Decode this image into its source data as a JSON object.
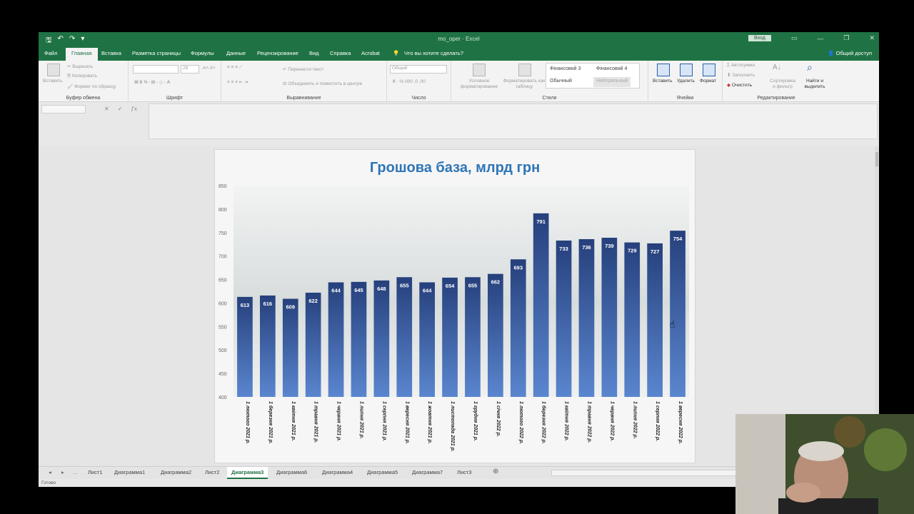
{
  "window": {
    "title": "mo_oper · Excel",
    "signin": "Вход",
    "share": "Общий доступ"
  },
  "tabs": [
    "Файл",
    "Главная",
    "Вставка",
    "Разметка страницы",
    "Формулы",
    "Данные",
    "Рецензирование",
    "Вид",
    "Справка",
    "Acrobat"
  ],
  "tell_me": "Что вы хотите сделать?",
  "ribbon": {
    "clipboard": {
      "paste": "Вставить",
      "cut": "Вырезать",
      "copy": "Копировать",
      "format_painter": "Формат по образцу",
      "label": "Буфер обмена"
    },
    "font": {
      "size": "28",
      "label": "Шрифт"
    },
    "alignment": {
      "wrap": "Перенести текст",
      "merge": "Объединить и поместить в центре",
      "label": "Выравнивание"
    },
    "number": {
      "format": "Общий",
      "label": "Число"
    },
    "styles": {
      "conditional": "Условное форматирование",
      "as_table": "Форматировать как таблицу",
      "cell_styles": [
        "Фінансовий 3",
        "Фінансовий 4",
        "Обычный",
        "Нейтральный"
      ],
      "label": "Стили"
    },
    "cells": {
      "insert": "Вставить",
      "delete": "Удалить",
      "format": "Формат",
      "label": "Ячейки"
    },
    "editing": {
      "autosum": "Автосумма",
      "fill": "Заполнить",
      "clear": "Очистить",
      "sort": "Сортировка и фильтр",
      "find": "Найти и выделить",
      "label": "Редактирование"
    }
  },
  "sheets": [
    "Лист1",
    "Диаграмма1",
    "Диаграмма2",
    "Лист2",
    "Диаграмма3",
    "Диаграмма6",
    "Диаграмма4",
    "Диаграмма5",
    "Диаграмма7",
    "Лист3"
  ],
  "active_sheet": "Диаграмма3",
  "status": "Готово",
  "colors": {
    "excel_green": "#1f7244",
    "bar_top": "#26407c",
    "bar_bottom": "#5a86cf",
    "title": "#2e75b6"
  },
  "chart_data": {
    "type": "bar",
    "title": "Грошова база, млрд грн",
    "categories": [
      "1 лютого 2021 р.",
      "1 березня 2021 р.",
      "1 квітня 2021 р.",
      "1 травня 2021 р.",
      "1 червня 2021 р.",
      "1 липня 2021 р.",
      "1 серпня 2021 р.",
      "1 вересня 2021 р.",
      "1 жовтня 2021 р.",
      "1 листопада 2021 р.",
      "1 грудня 2021 р.",
      "1 січня 2022 р.",
      "1 лютого 2022 р.",
      "1 березня 2022 р.",
      "1 квітня 2022 р.",
      "1 травня 2022 р.",
      "1 червня 2022 р.",
      "1 липня 2022 р.",
      "1 серпня 2022 р.",
      "1 вересня 2022 р."
    ],
    "values": [
      613,
      616,
      609,
      622,
      644,
      645,
      648,
      655,
      644,
      654,
      655,
      662,
      693,
      791,
      733,
      736,
      739,
      729,
      727,
      754
    ],
    "yticks": [
      400,
      450,
      500,
      550,
      600,
      650,
      700,
      750,
      800,
      850
    ],
    "ylim": [
      400,
      850
    ],
    "xlabel": "",
    "ylabel": "",
    "grid": false,
    "legend": "none"
  }
}
